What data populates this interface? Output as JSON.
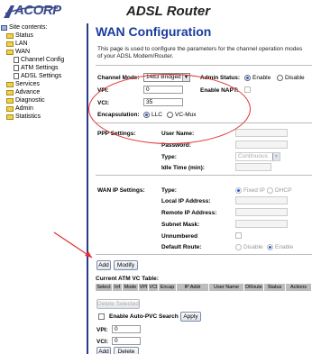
{
  "header": {
    "logo_text": "ACORP",
    "app_title": "ADSL Router"
  },
  "sidebar": {
    "items": [
      {
        "label": "Site contents:",
        "kind": "pc"
      },
      {
        "label": "Status",
        "kind": "folder"
      },
      {
        "label": "LAN",
        "kind": "folder"
      },
      {
        "label": "WAN",
        "kind": "folder-open"
      },
      {
        "label": "Channel Config",
        "kind": "page"
      },
      {
        "label": "ATM Settings",
        "kind": "page"
      },
      {
        "label": "ADSL Settings",
        "kind": "page"
      },
      {
        "label": "Services",
        "kind": "folder"
      },
      {
        "label": "Advance",
        "kind": "folder"
      },
      {
        "label": "Diagnostic",
        "kind": "folder"
      },
      {
        "label": "Admin",
        "kind": "folder"
      },
      {
        "label": "Statistics",
        "kind": "folder"
      }
    ]
  },
  "main": {
    "title": "WAN Configuration",
    "description": "This page is used to configure the parameters for the channel operation modes of your ADSL Modem/Router.",
    "channel": {
      "mode_label": "Channel Mode:",
      "mode_value": "1483 Bridged",
      "admin_status_label": "Admin Status:",
      "enable_label": "Enable",
      "disable_label": "Disable",
      "admin_status": "Enable",
      "vpi_label": "VPI:",
      "vpi_value": "0",
      "vci_label": "VCI:",
      "vci_value": "35",
      "napt_label": "Enable NAPT:",
      "encap_label": "Encapsulation:",
      "llc_label": "LLC",
      "vcmux_label": "VC-Mux",
      "encapsulation": "LLC"
    },
    "ppp": {
      "section_label": "PPP Settings:",
      "username_label": "User Name:",
      "password_label": "Password:",
      "type_label": "Type:",
      "type_value": "Continuous",
      "idle_label": "Idle Time (min):"
    },
    "wan_ip": {
      "section_label": "WAN IP Settings:",
      "type_label": "Type:",
      "fixed_ip_label": "Fixed IP",
      "dhcp_label": "DHCP",
      "local_ip_label": "Local IP Address:",
      "remote_ip_label": "Remote IP Address:",
      "subnet_label": "Subnet Mask:",
      "unnumbered_label": "Unnumbered",
      "default_route_label": "Default Route:",
      "dr_disable_label": "Disable",
      "dr_enable_label": "Enable"
    },
    "buttons": {
      "add": "Add",
      "modify": "Modify"
    },
    "atm_table": {
      "title": "Current ATM VC Table:",
      "columns": [
        "Select",
        "Inf",
        "Mode",
        "VPI",
        "VCI",
        "Encap",
        "IP Addr",
        "User Name",
        "DRoute",
        "Status",
        "Actions"
      ]
    },
    "delete_selected": "Delete Selected",
    "auto_pvc": {
      "label": "Enable Auto-PVC Search",
      "apply": "Apply"
    },
    "bottom": {
      "vpi_label": "VPI:",
      "vpi_value": "0",
      "vci_label": "VCI:",
      "vci_value": "0",
      "add": "Add",
      "delete": "Delete"
    }
  }
}
